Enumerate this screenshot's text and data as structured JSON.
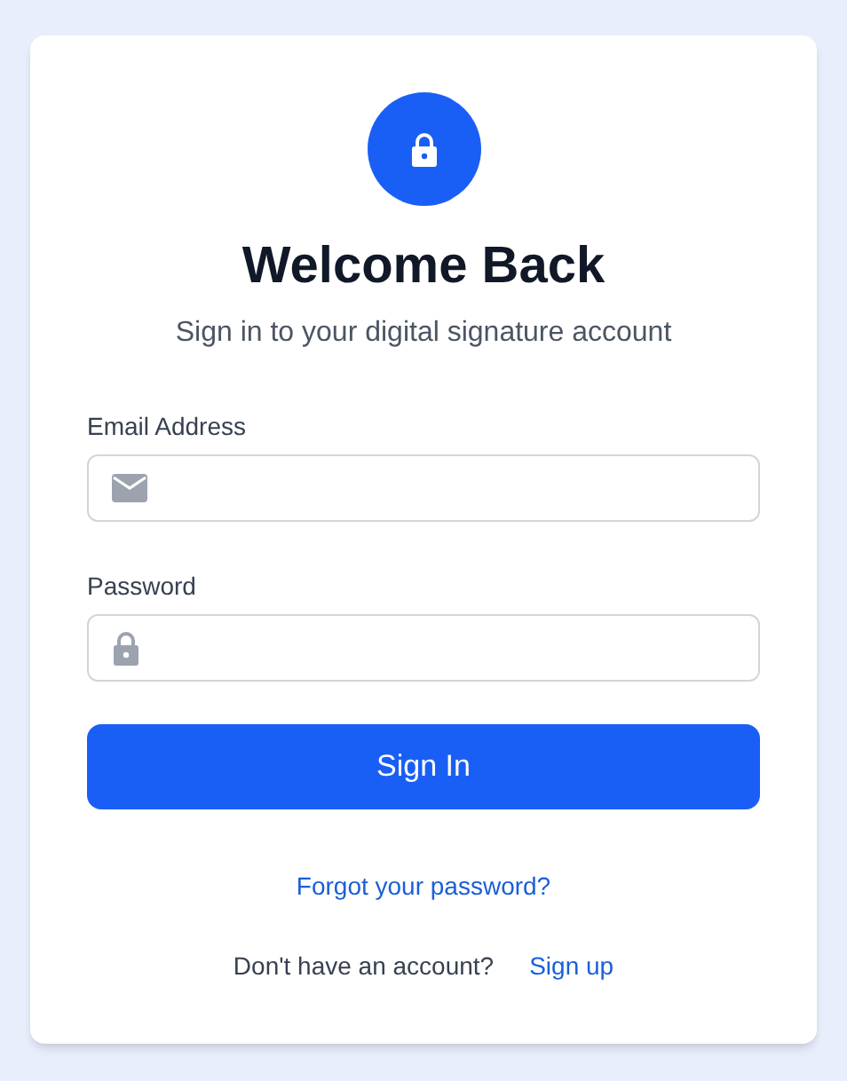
{
  "header": {
    "title": "Welcome Back",
    "subtitle": "Sign in to your digital signature account"
  },
  "fields": [
    {
      "kind": "email",
      "label": "Email Address"
    },
    {
      "kind": "password",
      "label": "Password"
    }
  ],
  "submit_button": "Sign In",
  "forgot_link": "Forgot your password?",
  "signup": {
    "prompt": "Don't have an account?",
    "link": "Sign up"
  }
}
